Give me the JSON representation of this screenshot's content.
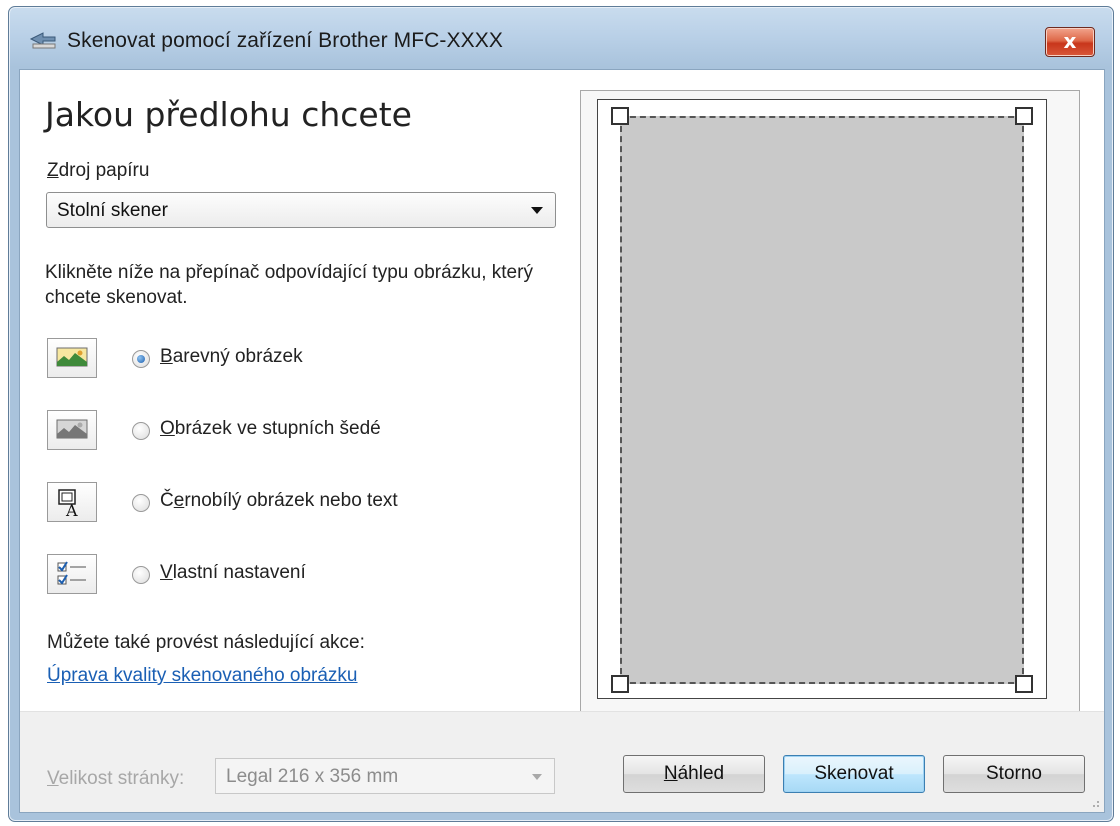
{
  "window": {
    "title": "Skenovat pomocí zařízení Brother MFC-XXXX",
    "close_label": "x"
  },
  "main": {
    "heading": "Jakou předlohu chcete",
    "paper_source": {
      "label_underlined": "Z",
      "label_rest": "droj papíru",
      "value": "Stolní skener"
    },
    "instruction": "Klikněte níže na přepínač odpovídající typu obrázku, který chcete skenovat.",
    "options": [
      {
        "underlined": "B",
        "rest": "arevný obrázek",
        "selected": true,
        "icon": "color-picture-icon"
      },
      {
        "underlined": "O",
        "rest": "brázek ve stupních šedé",
        "selected": false,
        "icon": "grayscale-picture-icon"
      },
      {
        "pre": "Č",
        "underlined": "e",
        "rest": "rnobílý obrázek nebo text",
        "selected": false,
        "icon": "black-white-text-icon"
      },
      {
        "underlined": "V",
        "rest": "lastní nastavení",
        "selected": false,
        "icon": "custom-settings-icon"
      }
    ],
    "also_text": "Můžete také provést následující akce:",
    "link": "Úprava kvality skenovaného obrázku"
  },
  "footer": {
    "page_size_label_underlined": "V",
    "page_size_label_rest": "elikost stránky:",
    "page_size_value": "Legal 216 x 356 mm",
    "preview_button_underlined": "N",
    "preview_button_rest": "áhled",
    "scan_button": "Skenovat",
    "cancel_button": "Storno"
  },
  "colors": {
    "link": "#1a5fb4",
    "titlebar": "#b9d0e7",
    "close_button": "#c8361b",
    "scan_area": "#c9c9c9"
  }
}
